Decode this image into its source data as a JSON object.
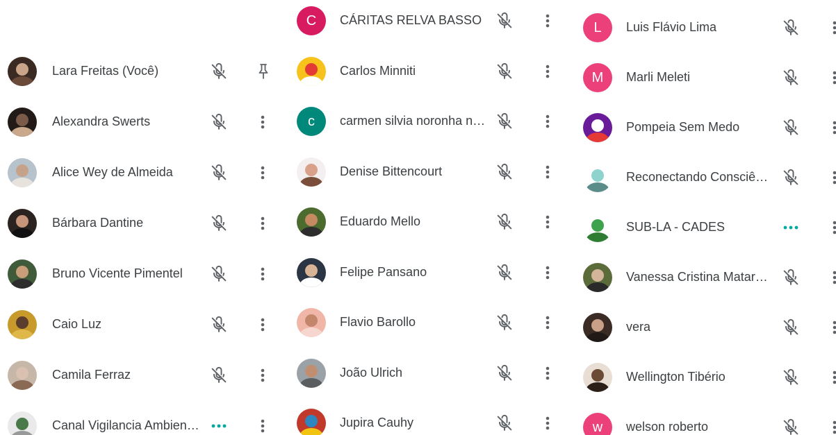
{
  "colors": {
    "text": "#3c4043",
    "icon": "#5f6368",
    "talking_dots": "#00a99d"
  },
  "columns": [
    {
      "participants": [
        {
          "name": "Lara Freitas (Você)",
          "avatar": "photo",
          "avatar_colors": [
            "#3a2a22",
            "#caa58a",
            "#6b4a3a"
          ],
          "status": "muted",
          "action": "pin-icon"
        },
        {
          "name": "Alexandra Swerts",
          "avatar": "photo",
          "avatar_colors": [
            "#221a16",
            "#7a5a48",
            "#c9a88c"
          ],
          "status": "muted",
          "action": "more-icon"
        },
        {
          "name": "Alice Wey de Almeida",
          "avatar": "photo",
          "avatar_colors": [
            "#b7c3cc",
            "#c7a28a",
            "#e7e2dc"
          ],
          "status": "muted",
          "action": "more-icon"
        },
        {
          "name": "Bárbara Dantine",
          "avatar": "photo",
          "avatar_colors": [
            "#2b2320",
            "#c7957a",
            "#111111"
          ],
          "status": "muted",
          "action": "more-icon"
        },
        {
          "name": "Bruno Vicente Pimentel",
          "avatar": "photo",
          "avatar_colors": [
            "#3f5b3a",
            "#c99c7a",
            "#2d2d2d"
          ],
          "status": "muted",
          "action": "more-icon"
        },
        {
          "name": "Caio Luz",
          "avatar": "photo",
          "avatar_colors": [
            "#c79a2b",
            "#5a3d2c",
            "#e0b84a"
          ],
          "status": "muted",
          "action": "more-icon"
        },
        {
          "name": "Camila Ferraz",
          "avatar": "photo",
          "avatar_colors": [
            "#c7b7a8",
            "#d9c0b0",
            "#8a6a55"
          ],
          "status": "muted",
          "action": "more-icon"
        },
        {
          "name": "Canal Vigilancia Ambien…",
          "avatar": "photo",
          "avatar_colors": [
            "#eaeaea",
            "#4a7a4a",
            "#999999"
          ],
          "status": "talking",
          "action": "more-icon"
        }
      ]
    },
    {
      "participants": [
        {
          "name": "CÁRITAS RELVA BASSO",
          "avatar": "letter",
          "letter": "C",
          "avatar_bg": "#d81b60",
          "status": "muted",
          "action": "more-icon"
        },
        {
          "name": "Carlos Minniti",
          "avatar": "photo",
          "avatar_colors": [
            "#f7c21b",
            "#e53935",
            "#ffffff"
          ],
          "status": "muted",
          "action": "more-icon"
        },
        {
          "name": "carmen silvia noronha n…",
          "avatar": "letter",
          "letter": "c",
          "avatar_bg": "#00897b",
          "status": "muted",
          "action": "more-icon"
        },
        {
          "name": "Denise Bittencourt",
          "avatar": "photo",
          "avatar_colors": [
            "#f2efee",
            "#d9a08a",
            "#7a4e3a"
          ],
          "status": "muted",
          "action": "more-icon"
        },
        {
          "name": "Eduardo Mello",
          "avatar": "photo",
          "avatar_colors": [
            "#4b6b2f",
            "#c58a62",
            "#2d2d2d"
          ],
          "status": "muted",
          "action": "more-icon"
        },
        {
          "name": "Felipe Pansano",
          "avatar": "photo",
          "avatar_colors": [
            "#2b3544",
            "#d9b395",
            "#ffffff"
          ],
          "status": "muted",
          "action": "more-icon"
        },
        {
          "name": "Flavio Barollo",
          "avatar": "photo",
          "avatar_colors": [
            "#f0b7a8",
            "#c4866a",
            "#f6d7cf"
          ],
          "status": "muted",
          "action": "more-icon"
        },
        {
          "name": "João Ulrich",
          "avatar": "photo",
          "avatar_colors": [
            "#9aa2a8",
            "#c08f72",
            "#5b5e60"
          ],
          "status": "muted",
          "action": "more-icon"
        },
        {
          "name": "Jupira Cauhy",
          "avatar": "photo",
          "avatar_colors": [
            "#c0392b",
            "#2e86c1",
            "#f1c40f"
          ],
          "status": "muted",
          "action": "more-icon"
        }
      ]
    },
    {
      "participants": [
        {
          "name": "Luis Flávio Lima",
          "avatar": "letter",
          "letter": "L",
          "avatar_bg": "#ec407a",
          "status": "muted",
          "action": "more-icon"
        },
        {
          "name": "Marli Meleti",
          "avatar": "letter",
          "letter": "M",
          "avatar_bg": "#ec407a",
          "status": "muted",
          "action": "more-icon"
        },
        {
          "name": "Pompeia Sem Medo",
          "avatar": "photo",
          "avatar_colors": [
            "#6a1b9a",
            "#ffffff",
            "#e53935"
          ],
          "status": "muted",
          "action": "more-icon"
        },
        {
          "name": "Reconectando Consciê…",
          "avatar": "photo",
          "avatar_colors": [
            "#ffffff",
            "#8fd3cf",
            "#5a8c8a"
          ],
          "status": "muted",
          "action": "more-icon"
        },
        {
          "name": "SUB-LA - CADES",
          "avatar": "photo",
          "avatar_colors": [
            "#ffffff",
            "#3fa34d",
            "#2e7d32"
          ],
          "status": "talking",
          "action": "more-icon"
        },
        {
          "name": "Vanessa Cristina Matar…",
          "avatar": "photo",
          "avatar_colors": [
            "#5b6b3a",
            "#d5b59a",
            "#2a2a2a"
          ],
          "status": "muted",
          "action": "more-icon"
        },
        {
          "name": "vera",
          "avatar": "photo",
          "avatar_colors": [
            "#3a2c24",
            "#c9a088",
            "#1f1a17"
          ],
          "status": "muted",
          "action": "more-icon"
        },
        {
          "name": "Wellington Tibério",
          "avatar": "photo",
          "avatar_colors": [
            "#e9ded4",
            "#6b4a36",
            "#2c1f18"
          ],
          "status": "muted",
          "action": "more-icon"
        },
        {
          "name": "welson roberto",
          "avatar": "letter",
          "letter": "w",
          "avatar_bg": "#ec407a",
          "status": "muted",
          "action": "more-icon"
        }
      ]
    }
  ]
}
